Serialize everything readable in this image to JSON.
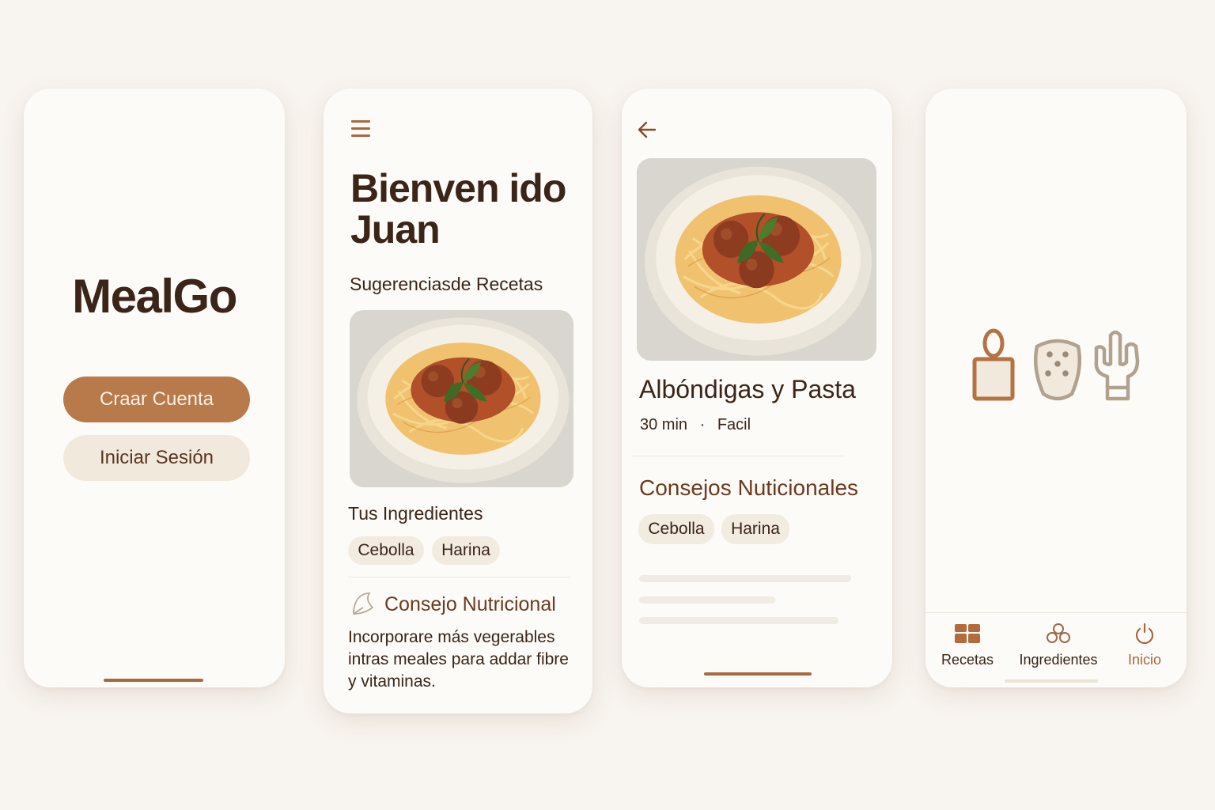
{
  "screen1": {
    "app_name": "MealGo",
    "create_account_label": "Craar Cuenta",
    "sign_in_label": "Iniciar Sesión"
  },
  "screen2": {
    "greeting_line1": "Bienven ido",
    "greeting_line2": "Juan",
    "suggestions_title": "Sugerenciasde Recetas",
    "ingredients_title": "Tus Ingredientes",
    "ingredients": [
      "Cebolla",
      "Harina"
    ],
    "tip_title": "Consejo Nutricional",
    "tip_text": "Incorporare más vegerables intras meales para addar fibre y vitaminas."
  },
  "screen3": {
    "recipe_name": "Albóndigas y Pasta",
    "time": "30 min",
    "separator": "·",
    "difficulty": "Facil",
    "tips_title": "Consejos Nuticionales",
    "tags": [
      "Cebolla",
      "Harina"
    ]
  },
  "screen4": {
    "illustration_icons": [
      "cutting-board-icon",
      "grater-icon",
      "whisk-icon"
    ],
    "tabs": [
      {
        "label": "Recetas",
        "icon": "grid-icon",
        "active": false
      },
      {
        "label": "Ingredientes",
        "icon": "ingredients-icon",
        "active": false
      },
      {
        "label": "Inicio",
        "icon": "power-icon",
        "active": true
      }
    ]
  },
  "colors": {
    "accent": "#a8693f",
    "primary_button": "#b87a4b",
    "secondary_button": "#f1e9dc",
    "text_dark": "#3b2418",
    "background": "#f8f4ef",
    "card": "#fdfbf7"
  }
}
